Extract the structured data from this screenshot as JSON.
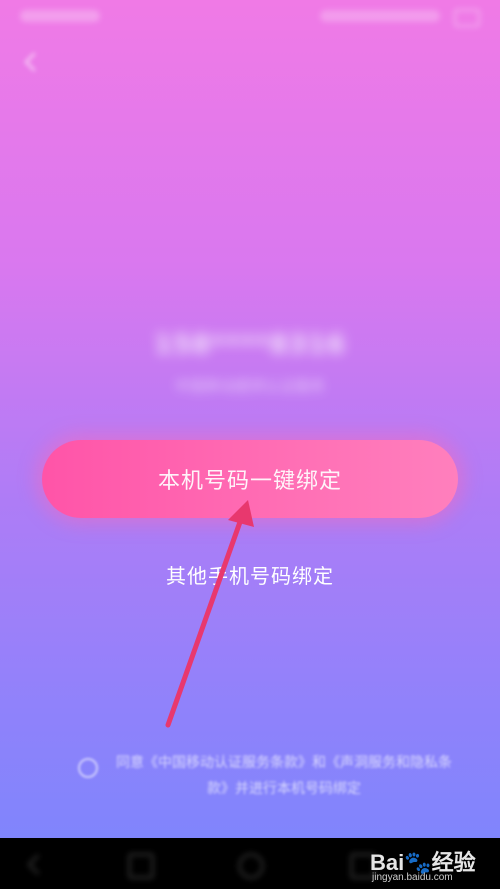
{
  "main": {
    "phone_masked": "158****8316",
    "phone_sub": "中国移动提供认证服务",
    "bind_button_label": "本机号码一键绑定",
    "other_bind_label": "其他手机号码绑定"
  },
  "agreement": {
    "text": "同意《中国移动认证服务条款》和《声洞服务和隐私条款》并进行本机号码绑定"
  },
  "watermark": {
    "logo_left": "Bai",
    "logo_right": "经验",
    "url": "jingyan.baidu.com"
  },
  "colors": {
    "gradient_top": "#f07ae6",
    "gradient_bottom": "#7a86fc",
    "button": "#ff54a8",
    "arrow": "#e8386e"
  }
}
